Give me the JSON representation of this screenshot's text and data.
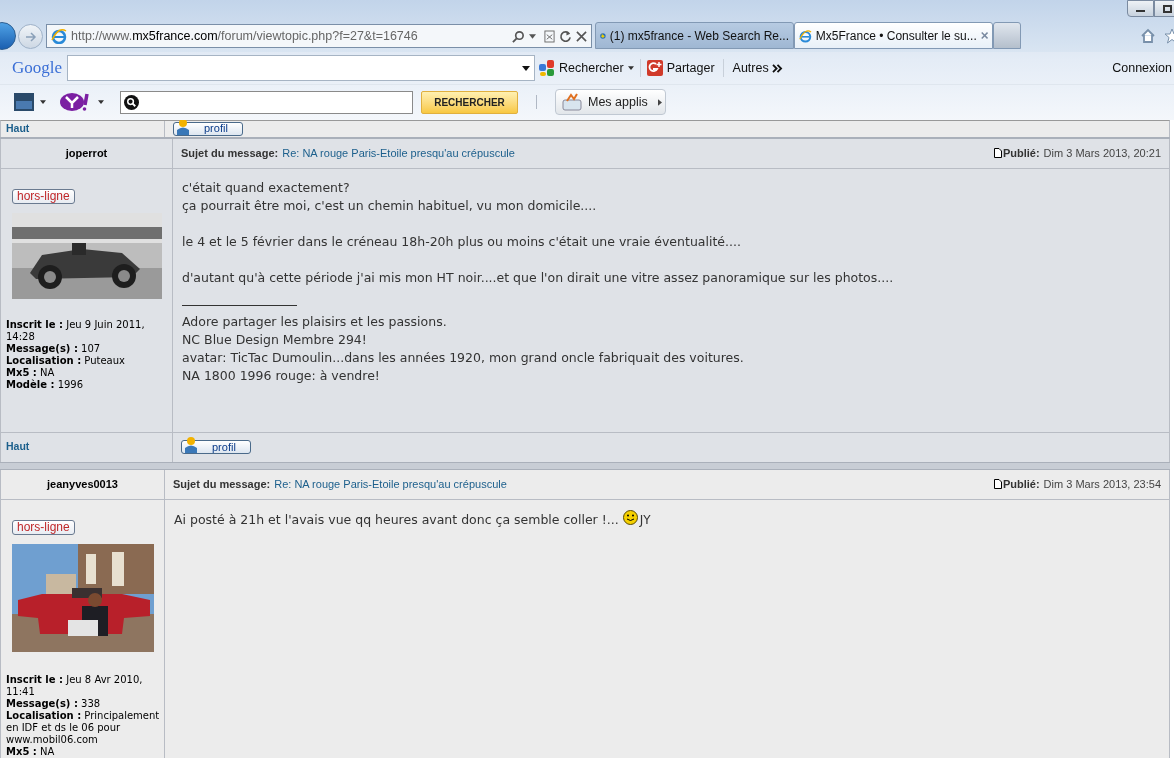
{
  "browser": {
    "address": {
      "prefix": "http://www.",
      "domain": "mx5france.com",
      "path": "/forum/viewtopic.php?f=27&t=16746"
    },
    "tabs": [
      {
        "title": "(1) mx5france - Web Search Re...",
        "selected": false,
        "kind": "bing"
      },
      {
        "title": "Mx5France • Consulter le su...",
        "selected": true,
        "kind": "ie"
      }
    ]
  },
  "google_toolbar": {
    "logo": "Google",
    "search_button": "Rechercher",
    "share_button": "Partager",
    "more_button": "Autres",
    "sign_in": "Connexion"
  },
  "yahoo_toolbar": {
    "search_button": "RECHERCHER",
    "apps_button": "Mes applis"
  },
  "top_row": {
    "link": "Haut",
    "button": "profil"
  },
  "posts": [
    {
      "author": "joperrot",
      "status": "hors-ligne",
      "avatar": {
        "kind": "picture"
      },
      "details": [
        {
          "label": "Inscrit le :",
          "value": "Jeu 9 Juin 2011, 14:28"
        },
        {
          "label": "Message(s) :",
          "value": "107"
        },
        {
          "label": "Localisation :",
          "value": "Puteaux"
        },
        {
          "label": "Mx5 :",
          "value": "NA"
        },
        {
          "label": "Modèle :",
          "value": "1996"
        }
      ],
      "subject_label": "Sujet du message:",
      "subject": "Re: NA rouge Paris-Etoile presqu'au crépuscule",
      "published_label": "Publié:",
      "date": "Dim 3 Mars 2013, 20:21",
      "paragraphs": [
        [
          "c'était quand exactement?",
          "ça pourrait être moi, c'est un chemin habituel, vu mon domicile...."
        ],
        [
          "le 4 et le 5 février dans le créneau 18h-20h plus ou moins c'était une vraie éventualité...."
        ],
        [
          "d'autant qu'à cette période j'ai mis mon HT noir....et que l'on dirait une vitre assez panoramique sur les photos...."
        ]
      ],
      "signature": [
        "Adore partager les plaisirs et les passions.",
        "NC Blue Design Membre 294!",
        "avatar: TicTac Dumoulin...dans les années 1920, mon grand oncle fabriquait des voitures.",
        "NA 1800 1996 rouge: à vendre!"
      ],
      "footer": {
        "link": "Haut",
        "button": "profil"
      }
    },
    {
      "author": "jeanyves0013",
      "status": "hors-ligne",
      "avatar": {
        "kind": "picture"
      },
      "details": [
        {
          "label": "Inscrit le :",
          "value": "Jeu 8 Avr 2010, 11:41"
        },
        {
          "label": "Message(s) :",
          "value": "338"
        },
        {
          "label": "Localisation :",
          "value": "Principalement en IDF et ds le 06 pour www.mobil06.com"
        },
        {
          "label": "Mx5 :",
          "value": "NA"
        }
      ],
      "subject_label": "Sujet du message:",
      "subject": "Re: NA rouge Paris-Etoile presqu'au crépuscule",
      "published_label": "Publié:",
      "date": "Dim 3 Mars 2013, 23:54",
      "paragraphs": [
        [
          "Ai posté à 21h et l'avais vue qq heures avant donc ça semble coller !..."
        ]
      ],
      "sign_off": "JY"
    }
  ]
}
